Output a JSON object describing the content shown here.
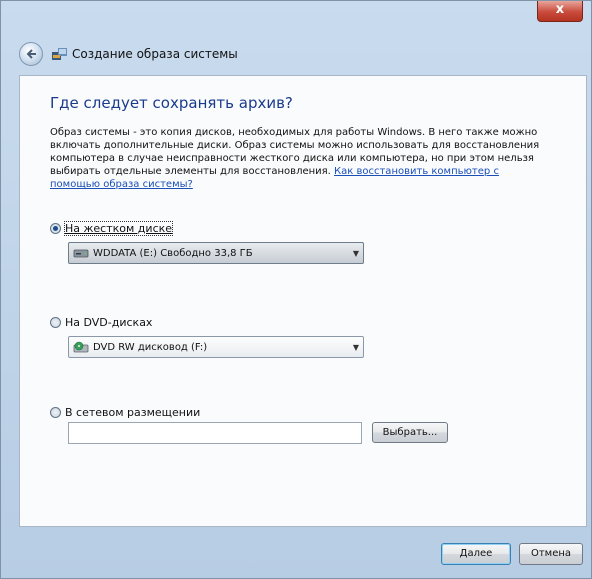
{
  "window": {
    "title": "Создание образа системы",
    "close_label": "x"
  },
  "page": {
    "heading": "Где следует сохранять архив?",
    "description": "Образ системы - это копия дисков, необходимых для работы Windows. В него также можно включать дополнительные диски. Образ системы можно использовать для восстановления компьютера в случае неисправности жесткого диска или компьютера, но при этом нельзя выбирать отдельные элементы для восстановления.",
    "help_link": "Как восстановить компьютер с помощью образа системы?"
  },
  "options": {
    "hdd": {
      "label": "На жестком диске",
      "selected": true,
      "value": "WDDATA (E:) Свободно 33,8 ГБ"
    },
    "dvd": {
      "label": "На DVD-дисках",
      "selected": false,
      "value": "DVD RW дисковод (F:)"
    },
    "network": {
      "label": "В сетевом размещении",
      "selected": false,
      "value": "",
      "browse_label": "Выбрать..."
    }
  },
  "footer": {
    "next_label": "Далее",
    "cancel_label": "Отмена"
  },
  "icons": {
    "back": "back-arrow-icon",
    "app": "system-image-icon",
    "hdd": "hard-drive-icon",
    "dvd": "dvd-drive-icon",
    "dropdown": "chevron-down-icon"
  }
}
